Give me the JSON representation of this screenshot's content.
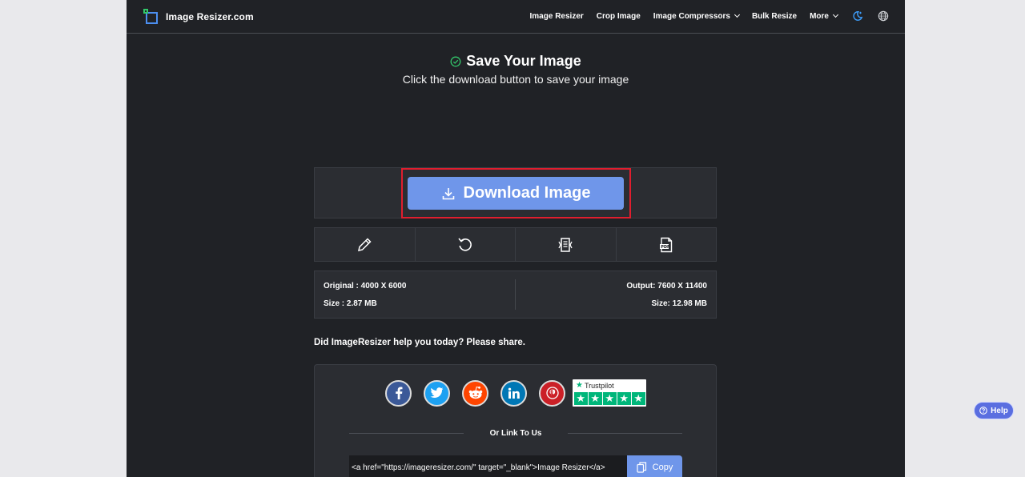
{
  "header": {
    "logo_text": "Image Resizer.com",
    "nav": [
      {
        "label": "Image Resizer"
      },
      {
        "label": "Crop Image"
      },
      {
        "label": "Image Compressors"
      },
      {
        "label": "Bulk Resize"
      },
      {
        "label": "More"
      }
    ]
  },
  "main": {
    "title": "Save Your Image",
    "subtitle": "Click the download button to save your image",
    "download_label": "Download Image",
    "tools": [
      "pencil-icon",
      "undo-icon",
      "compress-icon",
      "pdf-icon"
    ],
    "info": {
      "original": "Original : 4000 X 6000",
      "original_size": "Size : 2.87 MB",
      "output": "Output: 7600 X 11400",
      "output_size": "Size: 12.98 MB"
    },
    "share_question": "Did ImageResizer help you today? Please share.",
    "socials": [
      {
        "name": "facebook",
        "color": "#3b5998"
      },
      {
        "name": "twitter",
        "color": "#1da1f2"
      },
      {
        "name": "reddit",
        "color": "#ff4500"
      },
      {
        "name": "linkedin",
        "color": "#0077b5"
      },
      {
        "name": "pinterest",
        "color": "#cb2027"
      }
    ],
    "trustpilot_label": "Trustpilot",
    "or_link": "Or Link To Us",
    "embed_code": "<a href=\"https://imageresizer.com/\" target=\"_blank\">Image Resizer</a>",
    "copy_label": "Copy"
  },
  "help_label": "Help",
  "colors": {
    "accent": "#6f96ea",
    "highlight": "#e01e2e",
    "background": "#202226"
  }
}
